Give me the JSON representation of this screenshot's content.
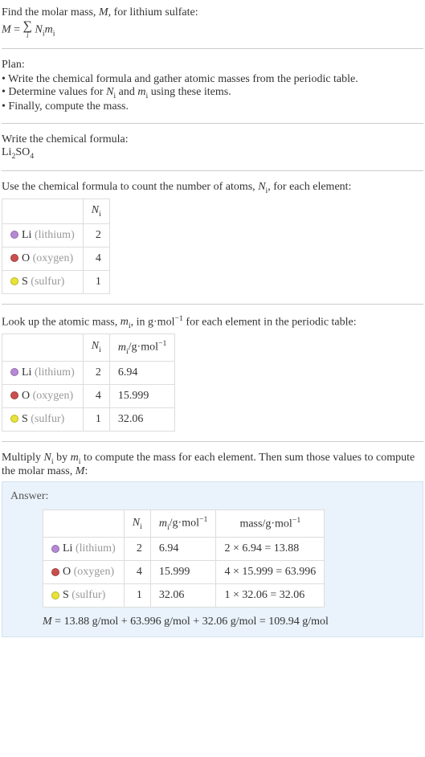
{
  "intro": {
    "line1": "Find the molar mass, M, for lithium sulfate:",
    "formula_lhs": "M",
    "formula_eq": " = ",
    "formula_rhs_after": " N",
    "formula_rhs_sub1": "i",
    "formula_rhs_m": "m",
    "formula_rhs_sub2": "i"
  },
  "plan": {
    "title": "Plan:",
    "items": [
      "• Write the chemical formula and gather atomic masses from the periodic table.",
      "• Determine values for Nᵢ and mᵢ using these items.",
      "• Finally, compute the mass."
    ]
  },
  "write_formula": {
    "title": "Write the chemical formula:",
    "formula_base": "Li",
    "formula_sub1": "2",
    "formula_mid": "SO",
    "formula_sub2": "4"
  },
  "count_atoms": {
    "title_part1": "Use the chemical formula to count the number of atoms, ",
    "title_var": "N",
    "title_sub": "i",
    "title_part2": ", for each element:",
    "header_ni": "N",
    "header_ni_sub": "i",
    "rows": [
      {
        "dot": "dot-li",
        "symbol": "Li",
        "name": "(lithium)",
        "ni": "2"
      },
      {
        "dot": "dot-o",
        "symbol": "O",
        "name": "(oxygen)",
        "ni": "4"
      },
      {
        "dot": "dot-s",
        "symbol": "S",
        "name": "(sulfur)",
        "ni": "1"
      }
    ]
  },
  "atomic_mass": {
    "title_part1": "Look up the atomic mass, ",
    "title_var": "m",
    "title_sub": "i",
    "title_part2": ", in g·mol",
    "title_sup": "−1",
    "title_part3": " for each element in the periodic table:",
    "header_mi": "m",
    "header_mi_sub": "i",
    "header_unit": "/g·mol",
    "header_unit_sup": "−1",
    "rows": [
      {
        "dot": "dot-li",
        "symbol": "Li",
        "name": "(lithium)",
        "ni": "2",
        "mi": "6.94"
      },
      {
        "dot": "dot-o",
        "symbol": "O",
        "name": "(oxygen)",
        "ni": "4",
        "mi": "15.999"
      },
      {
        "dot": "dot-s",
        "symbol": "S",
        "name": "(sulfur)",
        "ni": "1",
        "mi": "32.06"
      }
    ]
  },
  "multiply": {
    "text_part1": "Multiply ",
    "text_var1": "N",
    "text_sub1": "i",
    "text_part2": " by ",
    "text_var2": "m",
    "text_sub2": "i",
    "text_part3": " to compute the mass for each element. Then sum those values to compute the molar mass, ",
    "text_var3": "M",
    "text_part4": ":"
  },
  "answer": {
    "label": "Answer:",
    "header_mass": "mass/g·mol",
    "header_mass_sup": "−1",
    "rows": [
      {
        "dot": "dot-li",
        "symbol": "Li",
        "name": "(lithium)",
        "ni": "2",
        "mi": "6.94",
        "mass": "2 × 6.94 = 13.88"
      },
      {
        "dot": "dot-o",
        "symbol": "O",
        "name": "(oxygen)",
        "ni": "4",
        "mi": "15.999",
        "mass": "4 × 15.999 = 63.996"
      },
      {
        "dot": "dot-s",
        "symbol": "S",
        "name": "(sulfur)",
        "ni": "1",
        "mi": "32.06",
        "mass": "1 × 32.06 = 32.06"
      }
    ],
    "final_M": "M",
    "final_eq": " = 13.88 g/mol + 63.996 g/mol + 32.06 g/mol = 109.94 g/mol"
  }
}
